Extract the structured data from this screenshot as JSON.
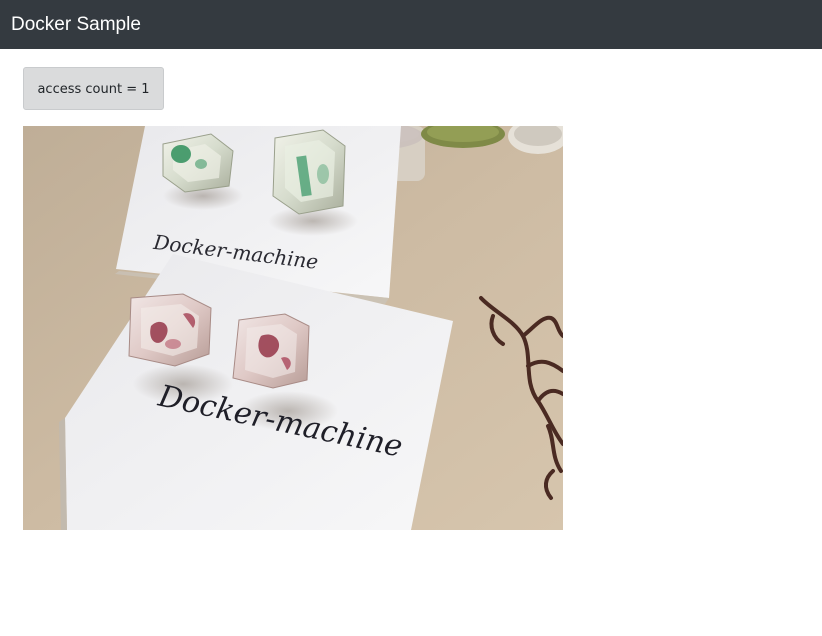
{
  "navbar": {
    "brand": "Docker Sample"
  },
  "counter": {
    "text": "access count = 1"
  },
  "photo": {
    "card_back_text": "Docker-machine",
    "card_front_text": "Docker-machine"
  },
  "colors": {
    "navbar_bg": "#343a40",
    "counter_bg": "#dadbdc",
    "table_bg": "#c9b69e"
  }
}
